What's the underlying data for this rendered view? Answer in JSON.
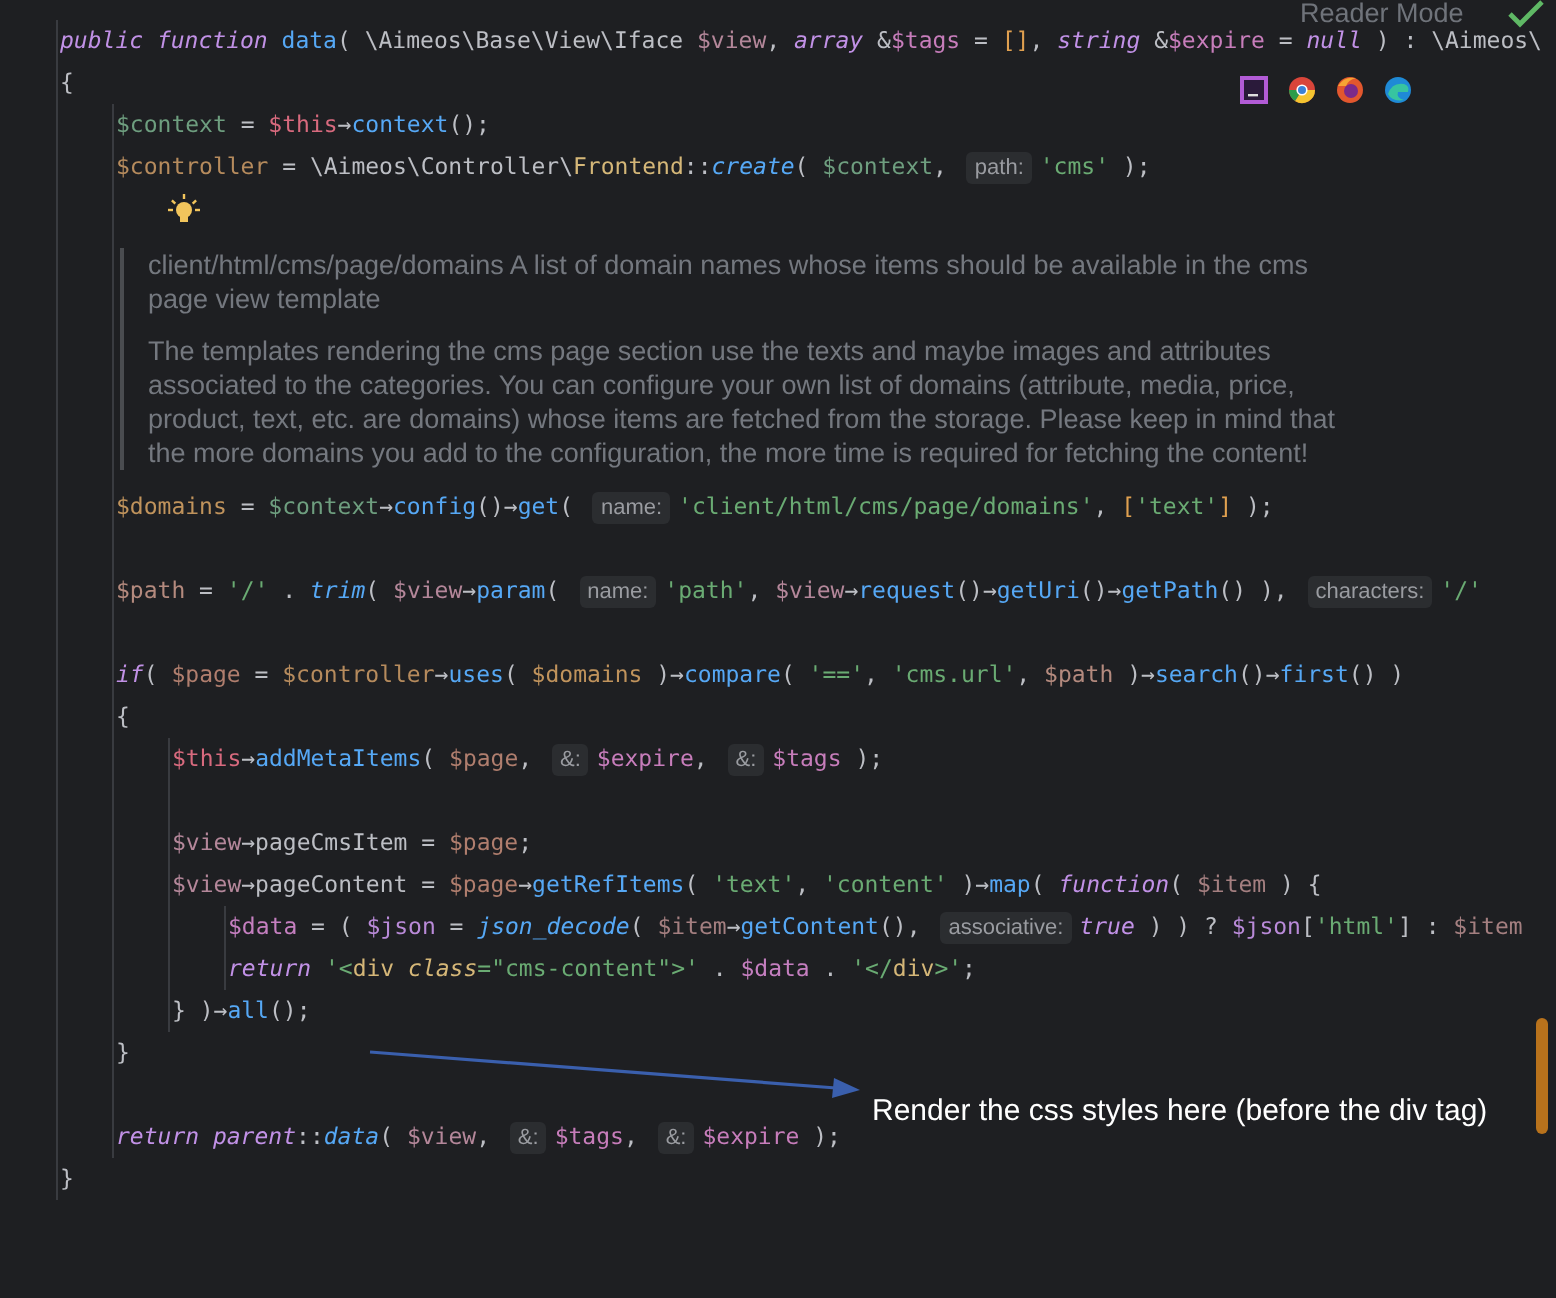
{
  "reader_mode": {
    "label": "Reader Mode"
  },
  "code": [
    {
      "kind": "line",
      "tokens": [
        {
          "text": "public function ",
          "kind": "keyword"
        },
        {
          "text": "data",
          "kind": "function"
        },
        {
          "text": "( \\Aimeos\\Base\\View\\Iface ",
          "kind": "plain"
        },
        {
          "text": "$view",
          "kind": "variable",
          "color": "#b4879a"
        },
        {
          "text": ", ",
          "kind": "plain"
        },
        {
          "text": "array ",
          "kind": "keyword"
        },
        {
          "text": "&",
          "kind": "plain"
        },
        {
          "text": "$tags",
          "kind": "variable",
          "color": "#c77dbb"
        },
        {
          "text": " = ",
          "kind": "plain"
        },
        {
          "text": "[]",
          "kind": "bracket"
        },
        {
          "text": ", ",
          "kind": "plain"
        },
        {
          "text": "string ",
          "kind": "keyword"
        },
        {
          "text": "&",
          "kind": "plain"
        },
        {
          "text": "$expire",
          "kind": "variable",
          "color": "#c77dbb"
        },
        {
          "text": " = ",
          "kind": "plain"
        },
        {
          "text": "null",
          "kind": "keyword"
        },
        {
          "text": " ) : \\Aimeos\\",
          "kind": "plain"
        }
      ]
    },
    {
      "kind": "line",
      "tokens": [
        {
          "text": "{",
          "kind": "plain"
        }
      ]
    },
    {
      "kind": "block",
      "children": [
        {
          "kind": "line",
          "tokens": [
            {
              "text": "$context",
              "kind": "variable",
              "color": "#6e9e7f"
            },
            {
              "text": " = ",
              "kind": "plain"
            },
            {
              "text": "$this",
              "kind": "this"
            },
            {
              "text": "→",
              "kind": "plain"
            },
            {
              "text": "context",
              "kind": "function"
            },
            {
              "text": "();",
              "kind": "plain"
            }
          ]
        },
        {
          "kind": "line",
          "tokens": [
            {
              "text": "$controller",
              "kind": "variable",
              "color": "#b68b5d"
            },
            {
              "text": " = \\Aimeos\\Controller\\",
              "kind": "plain"
            },
            {
              "text": "Frontend",
              "kind": "class"
            },
            {
              "text": "::",
              "kind": "plain"
            },
            {
              "text": "create",
              "kind": "static"
            },
            {
              "text": "( ",
              "kind": "plain"
            },
            {
              "text": "$context",
              "kind": "variable",
              "color": "#6e9e7f"
            },
            {
              "text": ", ",
              "kind": "plain"
            },
            {
              "text": "path:",
              "kind": "hint"
            },
            {
              "text": "'cms'",
              "kind": "string"
            },
            {
              "text": " );",
              "kind": "plain"
            }
          ]
        },
        {
          "kind": "bulb"
        },
        {
          "kind": "doc",
          "paragraphs": [
            "client/html/cms/page/domains A list of domain names whose items should be available in the cms page view template",
            "The templates rendering the cms page section use the texts and maybe images and attributes associated to the categories. You can configure your own list of domains (attribute, media, price, product, text, etc. are domains) whose items are fetched from the storage. Please keep in mind that the more domains you add to the configuration, the more time is required for fetching the content!"
          ]
        },
        {
          "kind": "line",
          "tokens": [
            {
              "text": "$domains",
              "kind": "variable",
              "color": "#c0935c"
            },
            {
              "text": " = ",
              "kind": "plain"
            },
            {
              "text": "$context",
              "kind": "variable",
              "color": "#6e9e7f"
            },
            {
              "text": "→",
              "kind": "plain"
            },
            {
              "text": "config",
              "kind": "function"
            },
            {
              "text": "()→",
              "kind": "plain"
            },
            {
              "text": "get",
              "kind": "function"
            },
            {
              "text": "( ",
              "kind": "plain"
            },
            {
              "text": "name:",
              "kind": "hint"
            },
            {
              "text": "'client/html/cms/page/domains'",
              "kind": "string"
            },
            {
              "text": ", ",
              "kind": "plain"
            },
            {
              "text": "[",
              "kind": "bracket"
            },
            {
              "text": "'text'",
              "kind": "string"
            },
            {
              "text": "]",
              "kind": "bracket"
            },
            {
              "text": " );",
              "kind": "plain"
            }
          ]
        },
        {
          "kind": "blank"
        },
        {
          "kind": "line",
          "tokens": [
            {
              "text": "$path",
              "kind": "variable",
              "color": "#b48a7e"
            },
            {
              "text": " = ",
              "kind": "plain"
            },
            {
              "text": "'/'",
              "kind": "string"
            },
            {
              "text": " . ",
              "kind": "plain"
            },
            {
              "text": "trim",
              "kind": "static"
            },
            {
              "text": "( ",
              "kind": "plain"
            },
            {
              "text": "$view",
              "kind": "variable",
              "color": "#b4879a"
            },
            {
              "text": "→",
              "kind": "plain"
            },
            {
              "text": "param",
              "kind": "function"
            },
            {
              "text": "( ",
              "kind": "plain"
            },
            {
              "text": "name:",
              "kind": "hint"
            },
            {
              "text": "'path'",
              "kind": "string"
            },
            {
              "text": ", ",
              "kind": "plain"
            },
            {
              "text": "$view",
              "kind": "variable",
              "color": "#b4879a"
            },
            {
              "text": "→",
              "kind": "plain"
            },
            {
              "text": "request",
              "kind": "function"
            },
            {
              "text": "()→",
              "kind": "plain"
            },
            {
              "text": "getUri",
              "kind": "function"
            },
            {
              "text": "()→",
              "kind": "plain"
            },
            {
              "text": "getPath",
              "kind": "function"
            },
            {
              "text": "() ), ",
              "kind": "plain"
            },
            {
              "text": "characters:",
              "kind": "hint"
            },
            {
              "text": "'/'",
              "kind": "string"
            }
          ]
        },
        {
          "kind": "blank"
        },
        {
          "kind": "line",
          "tokens": [
            {
              "text": "if",
              "kind": "keyword"
            },
            {
              "text": "( ",
              "kind": "plain"
            },
            {
              "text": "$page",
              "kind": "variable",
              "color": "#b07e6e"
            },
            {
              "text": " = ",
              "kind": "plain"
            },
            {
              "text": "$controller",
              "kind": "variable",
              "color": "#b68b5d"
            },
            {
              "text": "→",
              "kind": "plain"
            },
            {
              "text": "uses",
              "kind": "function"
            },
            {
              "text": "( ",
              "kind": "plain"
            },
            {
              "text": "$domains",
              "kind": "variable",
              "color": "#c0935c"
            },
            {
              "text": " )→",
              "kind": "plain"
            },
            {
              "text": "compare",
              "kind": "function"
            },
            {
              "text": "( ",
              "kind": "plain"
            },
            {
              "text": "'=='",
              "kind": "string"
            },
            {
              "text": ", ",
              "kind": "plain"
            },
            {
              "text": "'cms.url'",
              "kind": "string"
            },
            {
              "text": ", ",
              "kind": "plain"
            },
            {
              "text": "$path",
              "kind": "variable",
              "color": "#b48a7e"
            },
            {
              "text": " )→",
              "kind": "plain"
            },
            {
              "text": "search",
              "kind": "function"
            },
            {
              "text": "()→",
              "kind": "plain"
            },
            {
              "text": "first",
              "kind": "function"
            },
            {
              "text": "() )",
              "kind": "plain"
            }
          ]
        },
        {
          "kind": "line",
          "tokens": [
            {
              "text": "{",
              "kind": "plain"
            }
          ]
        },
        {
          "kind": "block",
          "children": [
            {
              "kind": "line",
              "tokens": [
                {
                  "text": "$this",
                  "kind": "this"
                },
                {
                  "text": "→",
                  "kind": "plain"
                },
                {
                  "text": "addMetaItems",
                  "kind": "function"
                },
                {
                  "text": "( ",
                  "kind": "plain"
                },
                {
                  "text": "$page",
                  "kind": "variable",
                  "color": "#b07e6e"
                },
                {
                  "text": ", ",
                  "kind": "plain"
                },
                {
                  "text": "&:",
                  "kind": "hint"
                },
                {
                  "text": "$expire",
                  "kind": "variable",
                  "color": "#c77dbb"
                },
                {
                  "text": ", ",
                  "kind": "plain"
                },
                {
                  "text": "&:",
                  "kind": "hint"
                },
                {
                  "text": "$tags",
                  "kind": "variable",
                  "color": "#c77dbb"
                },
                {
                  "text": " );",
                  "kind": "plain"
                }
              ]
            },
            {
              "kind": "blank"
            },
            {
              "kind": "line",
              "tokens": [
                {
                  "text": "$view",
                  "kind": "variable",
                  "color": "#b4879a"
                },
                {
                  "text": "→pageCmsItem = ",
                  "kind": "plain"
                },
                {
                  "text": "$page",
                  "kind": "variable",
                  "color": "#b07e6e"
                },
                {
                  "text": ";",
                  "kind": "plain"
                }
              ]
            },
            {
              "kind": "line",
              "tokens": [
                {
                  "text": "$view",
                  "kind": "variable",
                  "color": "#b4879a"
                },
                {
                  "text": "→pageContent = ",
                  "kind": "plain"
                },
                {
                  "text": "$page",
                  "kind": "variable",
                  "color": "#b07e6e"
                },
                {
                  "text": "→",
                  "kind": "plain"
                },
                {
                  "text": "getRefItems",
                  "kind": "function"
                },
                {
                  "text": "( ",
                  "kind": "plain"
                },
                {
                  "text": "'text'",
                  "kind": "string"
                },
                {
                  "text": ", ",
                  "kind": "plain"
                },
                {
                  "text": "'content'",
                  "kind": "string"
                },
                {
                  "text": " )→",
                  "kind": "plain"
                },
                {
                  "text": "map",
                  "kind": "function"
                },
                {
                  "text": "( ",
                  "kind": "plain"
                },
                {
                  "text": "function",
                  "kind": "keyword"
                },
                {
                  "text": "( ",
                  "kind": "plain"
                },
                {
                  "text": "$item",
                  "kind": "variable",
                  "color": "#a47f80"
                },
                {
                  "text": " ) {",
                  "kind": "plain"
                }
              ]
            },
            {
              "kind": "block",
              "children": [
                {
                  "kind": "line",
                  "tokens": [
                    {
                      "text": "$data",
                      "kind": "variable",
                      "color": "#c57fc0"
                    },
                    {
                      "text": " = ( ",
                      "kind": "plain"
                    },
                    {
                      "text": "$json",
                      "kind": "variable",
                      "color": "#b98ad8"
                    },
                    {
                      "text": " = ",
                      "kind": "plain"
                    },
                    {
                      "text": "json_decode",
                      "kind": "static"
                    },
                    {
                      "text": "( ",
                      "kind": "plain"
                    },
                    {
                      "text": "$item",
                      "kind": "variable",
                      "color": "#a47f80"
                    },
                    {
                      "text": "→",
                      "kind": "plain"
                    },
                    {
                      "text": "getContent",
                      "kind": "function"
                    },
                    {
                      "text": "(), ",
                      "kind": "plain"
                    },
                    {
                      "text": "associative:",
                      "kind": "hint"
                    },
                    {
                      "text": "true",
                      "kind": "keyword"
                    },
                    {
                      "text": " ) ) ? ",
                      "kind": "plain"
                    },
                    {
                      "text": "$json",
                      "kind": "variable",
                      "color": "#b98ad8"
                    },
                    {
                      "text": "[",
                      "kind": "plain"
                    },
                    {
                      "text": "'html'",
                      "kind": "string"
                    },
                    {
                      "text": "] : ",
                      "kind": "plain"
                    },
                    {
                      "text": "$item",
                      "kind": "variable",
                      "color": "#a47f80"
                    }
                  ]
                },
                {
                  "kind": "line",
                  "tokens": [
                    {
                      "text": "return ",
                      "kind": "keyword"
                    },
                    {
                      "text": "'<",
                      "kind": "string"
                    },
                    {
                      "text": "div",
                      "kind": "tag"
                    },
                    {
                      "text": " class",
                      "kind": "attribute"
                    },
                    {
                      "text": "=\"cms-content\">'",
                      "kind": "string"
                    },
                    {
                      "text": " . ",
                      "kind": "plain"
                    },
                    {
                      "text": "$data",
                      "kind": "variable",
                      "color": "#c57fc0"
                    },
                    {
                      "text": " . ",
                      "kind": "plain"
                    },
                    {
                      "text": "'</",
                      "kind": "string"
                    },
                    {
                      "text": "div",
                      "kind": "tag"
                    },
                    {
                      "text": ">'",
                      "kind": "string"
                    },
                    {
                      "text": ";",
                      "kind": "plain"
                    }
                  ]
                }
              ]
            },
            {
              "kind": "line",
              "tokens": [
                {
                  "text": "} )→",
                  "kind": "plain"
                },
                {
                  "text": "all",
                  "kind": "function"
                },
                {
                  "text": "();",
                  "kind": "plain"
                }
              ]
            }
          ]
        },
        {
          "kind": "line",
          "tokens": [
            {
              "text": "}",
              "kind": "plain"
            }
          ]
        },
        {
          "kind": "blank"
        },
        {
          "kind": "line",
          "tokens": [
            {
              "text": "return parent",
              "kind": "keyword"
            },
            {
              "text": "::",
              "kind": "plain"
            },
            {
              "text": "data",
              "kind": "static"
            },
            {
              "text": "( ",
              "kind": "plain"
            },
            {
              "text": "$view",
              "kind": "variable",
              "color": "#b4879a"
            },
            {
              "text": ", ",
              "kind": "plain"
            },
            {
              "text": "&:",
              "kind": "hint"
            },
            {
              "text": "$tags",
              "kind": "variable",
              "color": "#c77dbb"
            },
            {
              "text": ", ",
              "kind": "plain"
            },
            {
              "text": "&:",
              "kind": "hint"
            },
            {
              "text": "$expire",
              "kind": "variable",
              "color": "#c77dbb"
            },
            {
              "text": " );",
              "kind": "plain"
            }
          ]
        }
      ]
    },
    {
      "kind": "line",
      "tokens": [
        {
          "text": "}",
          "kind": "plain"
        }
      ]
    }
  ],
  "annotation": {
    "text": "Render the css styles here (before the div tag)"
  }
}
